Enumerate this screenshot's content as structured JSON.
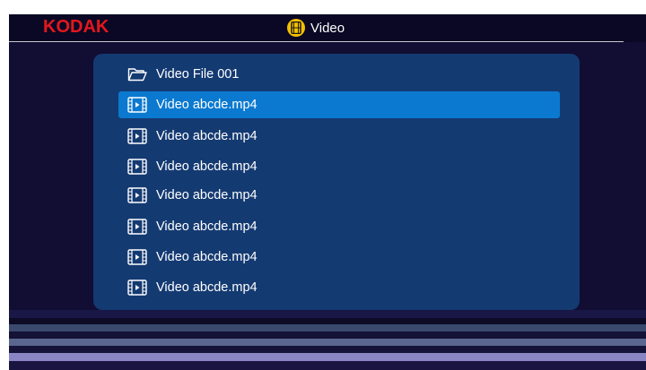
{
  "header": {
    "brand": "KODAK",
    "title": "Video",
    "colors": {
      "brand": "#e3171d",
      "title_badge": "#f5c000"
    }
  },
  "file_list": {
    "items": [
      {
        "label": "Video File 001",
        "icon": "folder-icon",
        "selected": false
      },
      {
        "label": "Video abcde.mp4",
        "icon": "video-file-icon",
        "selected": true
      },
      {
        "label": "Video abcde.mp4",
        "icon": "video-file-icon",
        "selected": false
      },
      {
        "label": "Video abcde.mp4",
        "icon": "video-file-icon",
        "selected": false
      },
      {
        "label": "Video abcde.mp4",
        "icon": "video-file-icon",
        "selected": false
      },
      {
        "label": "Video abcde.mp4",
        "icon": "video-file-icon",
        "selected": false
      },
      {
        "label": "Video abcde.mp4",
        "icon": "video-file-icon",
        "selected": false
      },
      {
        "label": "Video abcde.mp4",
        "icon": "video-file-icon",
        "selected": false
      }
    ],
    "colors": {
      "panel": "#143a72",
      "selection": "#0b79d0"
    }
  }
}
